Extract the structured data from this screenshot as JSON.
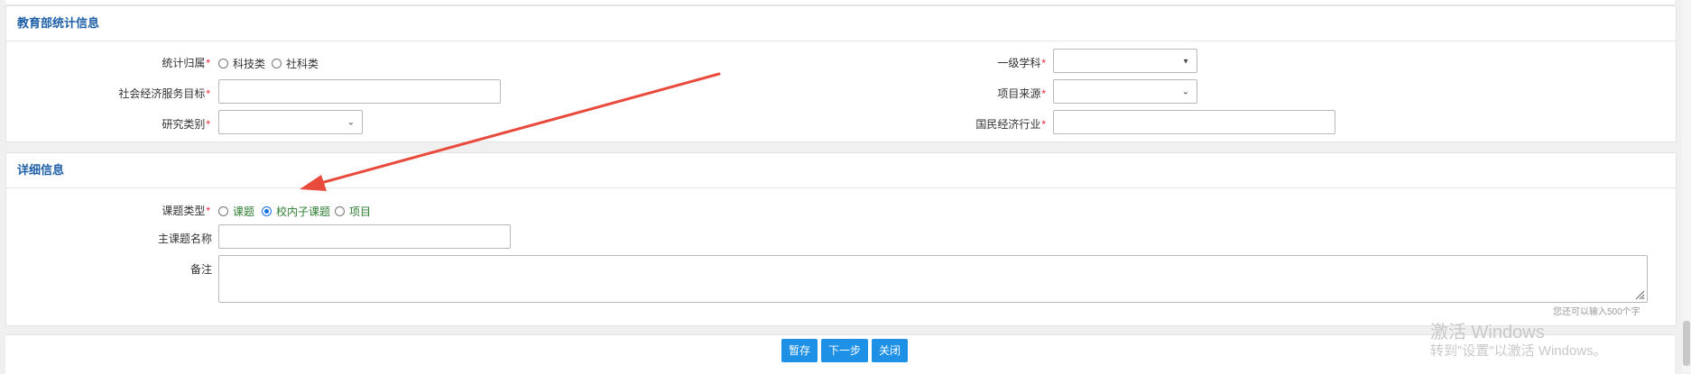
{
  "edu_section": {
    "title": "教育部统计信息",
    "stat_category": {
      "label": "统计归属",
      "options": [
        "科技类",
        "社科类"
      ]
    },
    "first_discipline": {
      "label": "一级学科",
      "value": ""
    },
    "social_goal": {
      "label": "社会经济服务目标",
      "value": ""
    },
    "project_source": {
      "label": "项目来源",
      "value": ""
    },
    "research_type": {
      "label": "研究类别",
      "value": ""
    },
    "economy_industry": {
      "label": "国民经济行业",
      "value": ""
    },
    "required_mark": "*"
  },
  "detail_section": {
    "title": "详细信息",
    "topic_type": {
      "label": "课题类型",
      "options": [
        "课题",
        "校内子课题",
        "项目"
      ],
      "selected": "校内子课题"
    },
    "main_topic_name": {
      "label": "主课题名称",
      "value": ""
    },
    "remark": {
      "label": "备注",
      "value": "",
      "counter": "您还可以输入500个字"
    }
  },
  "buttons": {
    "save_draft": "暂存",
    "next_step": "下一步",
    "close": "关闭"
  },
  "watermark": {
    "line1": "激活 Windows",
    "line2": "转到\"设置\"以激活 Windows。"
  },
  "colors": {
    "accent": "#1e90e6",
    "title": "#1f5fa6",
    "required": "#e22233",
    "arrow": "#e84a3c",
    "option_green": "#2e7d32"
  },
  "annotation": {
    "icon": "red-arrow-icon"
  }
}
